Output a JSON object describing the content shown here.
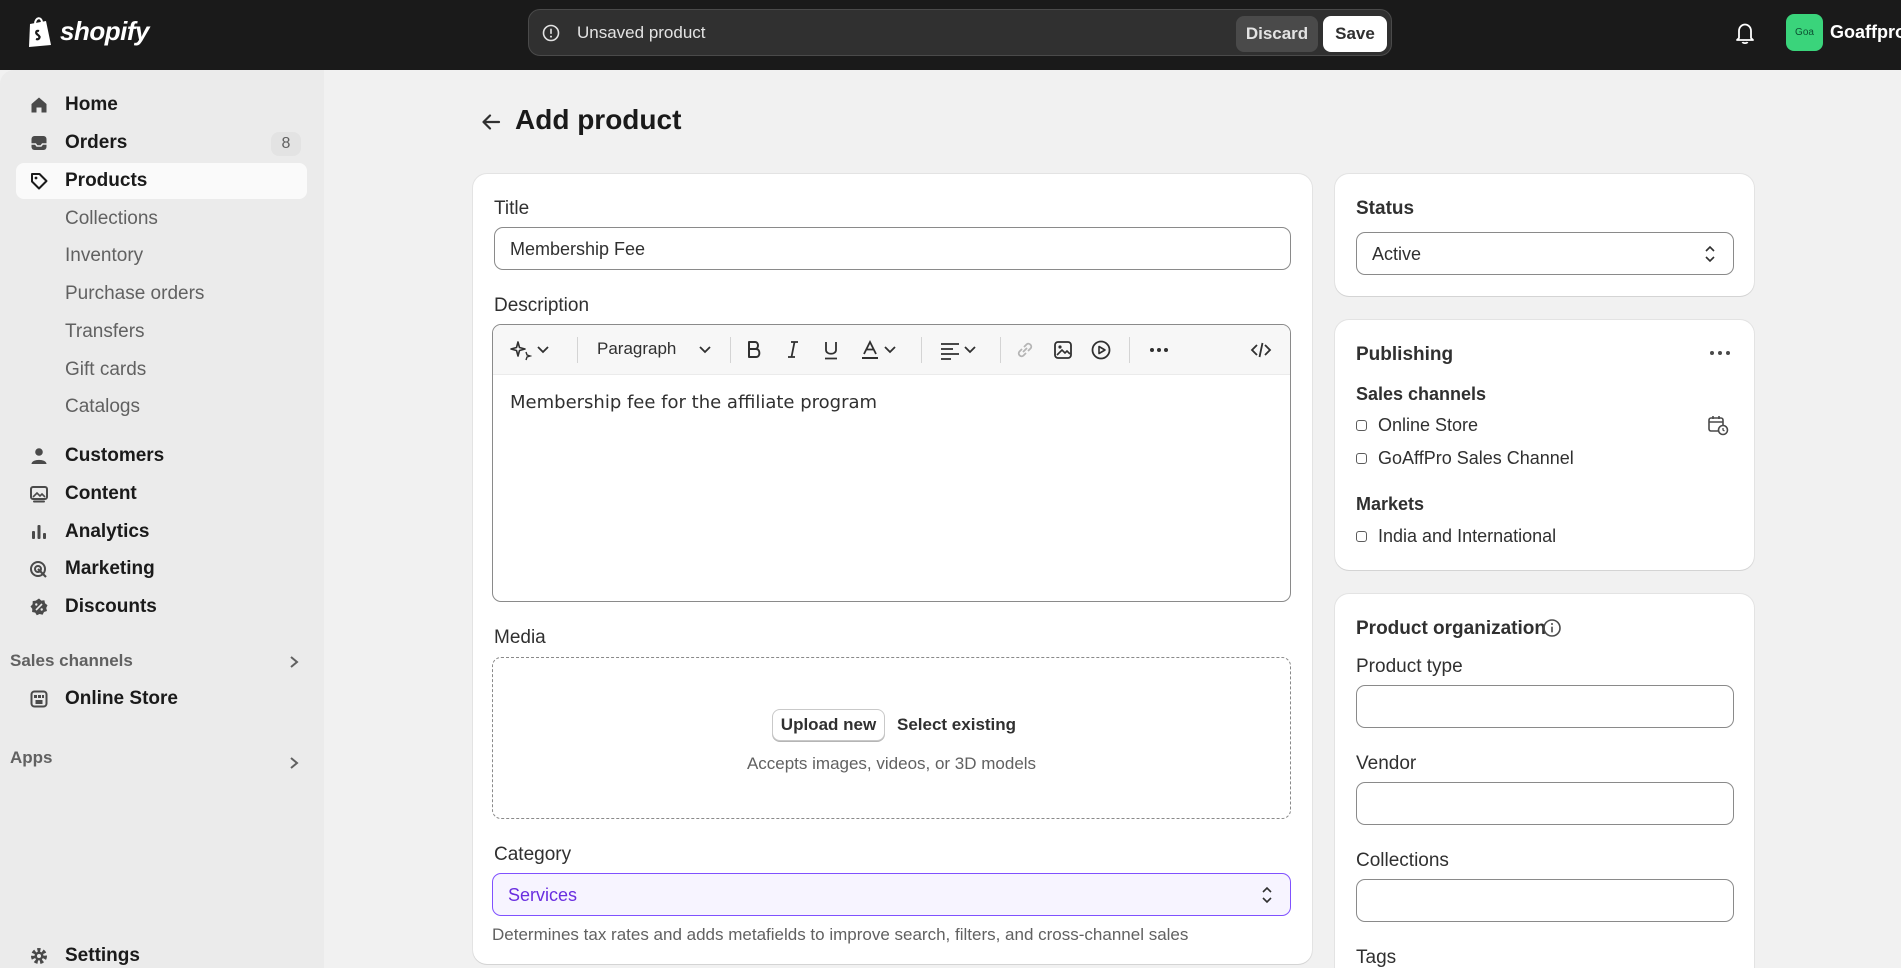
{
  "topbar": {
    "brand": "shopify",
    "unsaved_message": "Unsaved product",
    "discard_label": "Discard",
    "save_label": "Save",
    "avatar_initials": "Goa",
    "store_name": "Goaffpro"
  },
  "sidebar": {
    "home": "Home",
    "orders": "Orders",
    "orders_count": "8",
    "products": "Products",
    "collections": "Collections",
    "inventory": "Inventory",
    "purchase_orders": "Purchase orders",
    "transfers": "Transfers",
    "gift_cards": "Gift cards",
    "catalogs": "Catalogs",
    "customers": "Customers",
    "content": "Content",
    "analytics": "Analytics",
    "marketing": "Marketing",
    "discounts": "Discounts",
    "sales_channels_heading": "Sales channels",
    "online_store": "Online Store",
    "apps_heading": "Apps",
    "settings": "Settings"
  },
  "page": {
    "title": "Add product"
  },
  "product_form": {
    "title_label": "Title",
    "title_value": "Membership Fee",
    "description_label": "Description",
    "paragraph_label": "Paragraph",
    "description_value": "Membership fee for the affiliate program",
    "media_label": "Media",
    "upload_new": "Upload new",
    "select_existing": "Select existing",
    "media_hint": "Accepts images, videos, or 3D models",
    "category_label": "Category",
    "category_value": "Services",
    "category_hint": "Determines tax rates and adds metafields to improve search, filters, and cross-channel sales"
  },
  "status_card": {
    "title": "Status",
    "value": "Active"
  },
  "publishing_card": {
    "title": "Publishing",
    "sales_channels_label": "Sales channels",
    "channels": [
      "Online Store",
      "GoAffPro Sales Channel"
    ],
    "markets_label": "Markets",
    "markets": [
      "India and International"
    ]
  },
  "organization_card": {
    "title": "Product organization",
    "product_type_label": "Product type",
    "vendor_label": "Vendor",
    "collections_label": "Collections",
    "tags_label": "Tags"
  },
  "colors": {
    "topbar_bg": "#1a1a1a",
    "accent_purple": "#8051ff",
    "avatar_green": "#3ad47b"
  }
}
